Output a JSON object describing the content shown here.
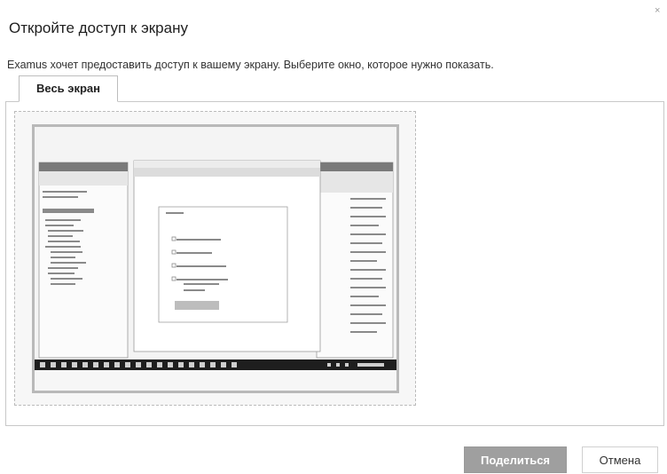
{
  "dialog": {
    "title": "Откройте доступ к экрану",
    "close_glyph": "×",
    "description": "Examus хочет предоставить доступ к вашему экрану. Выберите окно, которое нужно показать."
  },
  "tabs": [
    {
      "label": "Весь экран",
      "active": true
    }
  ],
  "screen_preview": {
    "label": "Весь экран"
  },
  "buttons": {
    "share": "Поделиться",
    "cancel": "Отмена"
  },
  "colors": {
    "share_bg": "#9f9f9f",
    "taskbar": "#1e1e1e",
    "preview_border": "#b9b9b9"
  },
  "icons": {
    "close": "close-icon"
  }
}
